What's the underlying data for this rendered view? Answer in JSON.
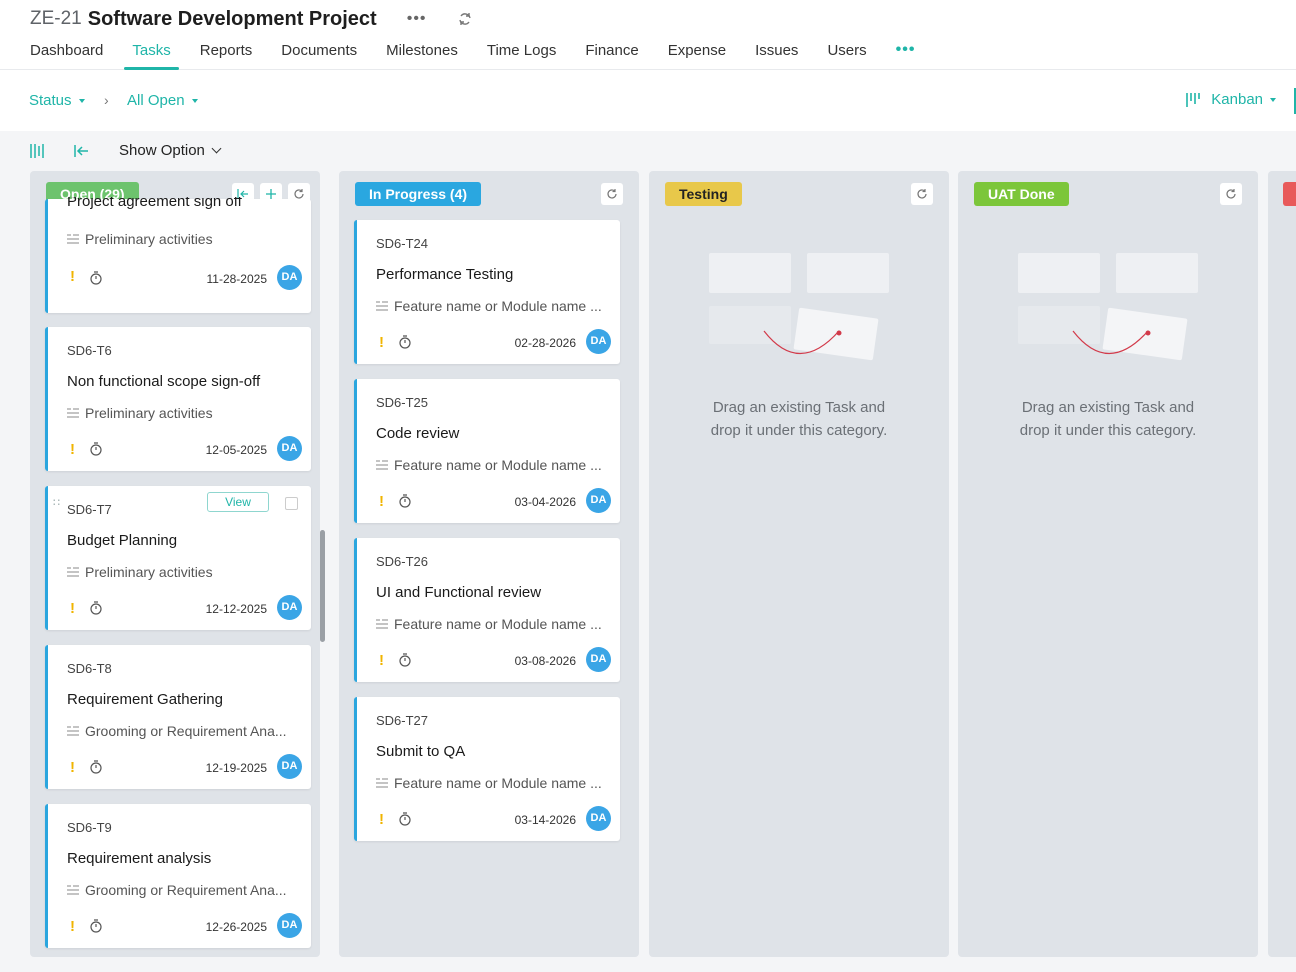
{
  "header": {
    "project_id": "ZE-21",
    "project_name": "Software Development Project",
    "more": "•••"
  },
  "tabs": [
    {
      "label": "Dashboard"
    },
    {
      "label": "Tasks"
    },
    {
      "label": "Reports"
    },
    {
      "label": "Documents"
    },
    {
      "label": "Milestones"
    },
    {
      "label": "Time Logs"
    },
    {
      "label": "Finance"
    },
    {
      "label": "Expense"
    },
    {
      "label": "Issues"
    },
    {
      "label": "Users"
    }
  ],
  "tabs_more": "•••",
  "filters": {
    "status": "Status",
    "separator": "›",
    "all_open": "All Open",
    "view": "Kanban"
  },
  "toolbar": {
    "show_option": "Show Option"
  },
  "columns": [
    {
      "title": "Open (29)",
      "color": "#6dc36d",
      "cards": [
        {
          "id": "",
          "name": "Project agreement sign off",
          "list": "Preliminary activities",
          "priority": "!",
          "date": "11-28-2025",
          "owner": "DA"
        },
        {
          "id": "SD6-T6",
          "name": "Non functional scope sign-off",
          "list": "Preliminary activities",
          "priority": "!",
          "date": "12-05-2025",
          "owner": "DA"
        },
        {
          "id": "SD6-T7",
          "name": "Budget Planning",
          "list": "Preliminary activities",
          "priority": "!",
          "date": "12-12-2025",
          "owner": "DA",
          "view": "View",
          "drag": "∷"
        },
        {
          "id": "SD6-T8",
          "name": "Requirement Gathering",
          "list": "Grooming or Requirement Ana...",
          "priority": "!",
          "date": "12-19-2025",
          "owner": "DA"
        },
        {
          "id": "SD6-T9",
          "name": "Requirement analysis",
          "list": "Grooming or Requirement Ana...",
          "priority": "!",
          "date": "12-26-2025",
          "owner": "DA"
        }
      ]
    },
    {
      "title": "In Progress (4)",
      "color": "#2aa7e0",
      "cards": [
        {
          "id": "SD6-T24",
          "name": "Performance Testing",
          "list": "Feature name or Module name ...",
          "priority": "!",
          "date": "02-28-2026",
          "owner": "DA"
        },
        {
          "id": "SD6-T25",
          "name": "Code review",
          "list": "Feature name or Module name ...",
          "priority": "!",
          "date": "03-04-2026",
          "owner": "DA"
        },
        {
          "id": "SD6-T26",
          "name": "UI and Functional review",
          "list": "Feature name or Module name ...",
          "priority": "!",
          "date": "03-08-2026",
          "owner": "DA"
        },
        {
          "id": "SD6-T27",
          "name": "Submit to QA",
          "list": "Feature name or Module name ...",
          "priority": "!",
          "date": "03-14-2026",
          "owner": "DA"
        }
      ]
    },
    {
      "title": "Testing",
      "color": "#e8c84a",
      "empty_line1": "Drag an existing Task and",
      "empty_line2": "drop it under this category."
    },
    {
      "title": "UAT Done",
      "color": "#7cc63a",
      "empty_line1": "Drag an existing Task and",
      "empty_line2": "drop it under this category."
    }
  ],
  "colors": {
    "accent": "#1fb5a8",
    "card_border": "#2ba6de",
    "avatar": "#3aa5e6",
    "priority": "#f0b400"
  }
}
